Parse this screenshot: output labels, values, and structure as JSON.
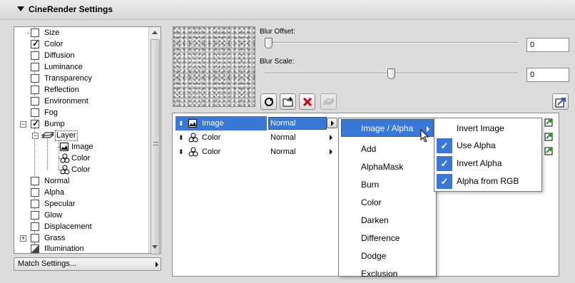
{
  "header": {
    "title": "CineRender Settings"
  },
  "channels": [
    {
      "label": "Size",
      "checked": false
    },
    {
      "label": "Color",
      "checked": true
    },
    {
      "label": "Diffusion",
      "checked": false
    },
    {
      "label": "Luminance",
      "checked": false
    },
    {
      "label": "Transparency",
      "checked": false
    },
    {
      "label": "Reflection",
      "checked": false
    },
    {
      "label": "Environment",
      "checked": false
    },
    {
      "label": "Fog",
      "checked": false
    },
    {
      "label": "Bump",
      "checked": true
    },
    {
      "label": "Layer"
    },
    {
      "label": "Image"
    },
    {
      "label": "Color"
    },
    {
      "label": "Color"
    },
    {
      "label": "Normal",
      "checked": false
    },
    {
      "label": "Alpha",
      "checked": false
    },
    {
      "label": "Specular",
      "checked": false
    },
    {
      "label": "Glow",
      "checked": false
    },
    {
      "label": "Displacement",
      "checked": false
    },
    {
      "label": "Grass",
      "checked": false
    },
    {
      "label": "Illumination",
      "checked": false
    }
  ],
  "match_settings": {
    "label": "Match Settings..."
  },
  "blur_offset": {
    "label": "Blur Offset:",
    "value": "0",
    "slider_fraction": 0.0
  },
  "blur_scale": {
    "label": "Blur Scale:",
    "value": "0",
    "slider_fraction": 0.5
  },
  "toolbar": {
    "icons": [
      "refresh-icon",
      "new-folder-icon",
      "delete-icon",
      "layers-icon",
      "export-icon"
    ]
  },
  "layers": [
    {
      "name": "Image",
      "mode": "Normal",
      "selected": true
    },
    {
      "name": "Color",
      "mode": "Normal",
      "selected": false
    },
    {
      "name": "Color",
      "mode": "Normal",
      "selected": false
    }
  ],
  "blend_menu": {
    "items": [
      "Image / Alpha",
      "Add",
      "AlphaMask",
      "Burn",
      "Color",
      "Darken",
      "Difference",
      "Dodge",
      "Exclusion"
    ],
    "highlighted": "Image / Alpha"
  },
  "alpha_menu": {
    "items": [
      {
        "label": "Invert Image",
        "checked": false
      },
      {
        "label": "Use Alpha",
        "checked": true
      },
      {
        "label": "Invert Alpha",
        "checked": true
      },
      {
        "label": "Alpha from RGB",
        "checked": true
      }
    ]
  },
  "colors": {
    "selection": "#3a78d8",
    "background": "#dcdcdc"
  }
}
